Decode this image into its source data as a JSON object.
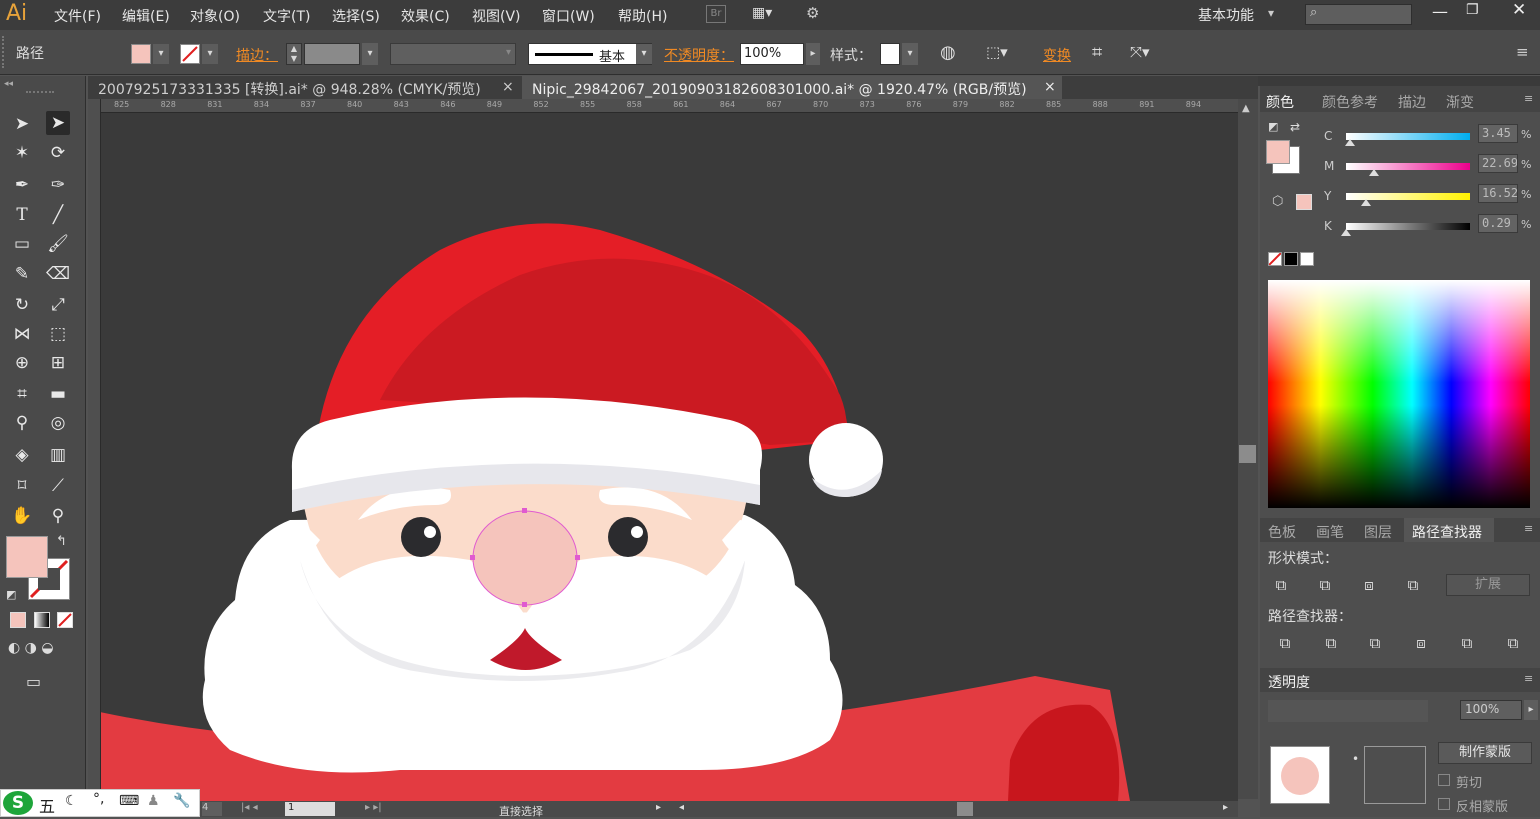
{
  "app": {
    "logo": "Ai"
  },
  "menu": [
    "文件(F)",
    "编辑(E)",
    "对象(O)",
    "文字(T)",
    "选择(S)",
    "效果(C)",
    "视图(V)",
    "窗口(W)",
    "帮助(H)"
  ],
  "menu_extra": {
    "bridge": "Br",
    "workspace": "基本功能"
  },
  "control_bar": {
    "selection_label": "路径",
    "stroke_label": "描边：",
    "stroke_style": "基本",
    "opacity_label": "不透明度：",
    "opacity_value": "100%",
    "style_label": "样式：",
    "transform_label": "变换"
  },
  "tabs": [
    {
      "label": "2007925173331335 [转换].ai* @ 948.28% (CMYK/预览)",
      "close": "×"
    },
    {
      "label": "Nipic_29842067_20190903182608301000.ai* @ 1920.47% (RGB/预览)",
      "close": "×"
    }
  ],
  "ruler_ticks": [
    "825",
    "828",
    "831",
    "834",
    "837",
    "840",
    "843",
    "846",
    "849",
    "852",
    "855",
    "858",
    "861",
    "864",
    "867",
    "870",
    "873",
    "876",
    "879",
    "882",
    "885",
    "888",
    "891",
    "894"
  ],
  "colors": {
    "fill": "#f5c4bc",
    "hat_red": "#e41e26",
    "hat_dark": "#cb1a22",
    "face": "#fbdccb",
    "white": "#ffffff",
    "beard_shadow": "#ebebee",
    "coat": "#e33b41",
    "anchor": "#e05ad0"
  },
  "color_panel": {
    "tabs": [
      "颜色",
      "颜色参考",
      "描边",
      "渐变"
    ],
    "channels": [
      {
        "name": "C",
        "value": "3.45",
        "pct": 3.45,
        "unit": "%"
      },
      {
        "name": "M",
        "value": "22.69",
        "pct": 22.69,
        "unit": "%"
      },
      {
        "name": "Y",
        "value": "16.52",
        "pct": 16.52,
        "unit": "%"
      },
      {
        "name": "K",
        "value": "0.29",
        "pct": 0.29,
        "unit": "%"
      }
    ]
  },
  "pathfinder_panel": {
    "tabs": [
      "色板",
      "画笔",
      "图层",
      "路径查找器"
    ],
    "shape_modes_label": "形状模式：",
    "expand_label": "扩展",
    "pathfinders_label": "路径查找器："
  },
  "transparency_panel": {
    "tab": "透明度",
    "opacity_value": "100%",
    "make_mask": "制作蒙版",
    "clip": "剪切",
    "invert_mask": "反相蒙版"
  },
  "status_bar": {
    "zoom": "4",
    "artboard": "1",
    "tool": "直接选择"
  },
  "ime": {
    "lang": "五"
  }
}
